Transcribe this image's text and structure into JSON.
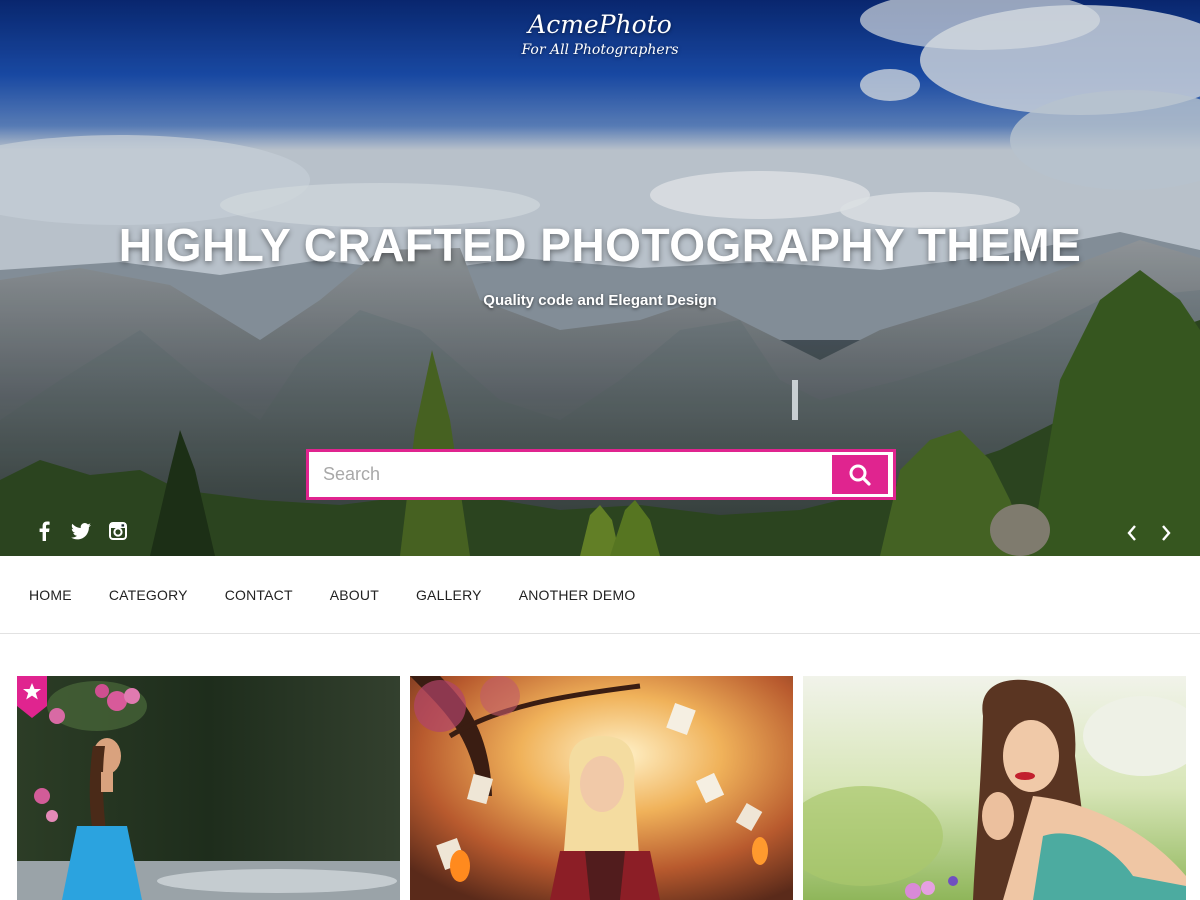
{
  "site": {
    "title": "AcmePhoto",
    "tagline": "For All Photographers"
  },
  "hero": {
    "heading": "HIGHLY CRAFTED PHOTOGRAPHY THEME",
    "subheading": "Quality code and Elegant Design"
  },
  "search": {
    "placeholder": "Search",
    "value": ""
  },
  "social": [
    "facebook-icon",
    "twitter-icon",
    "instagram-icon"
  ],
  "slider_controls": [
    "chevron-left-icon",
    "chevron-right-icon"
  ],
  "nav": {
    "items": [
      "HOME",
      "CATEGORY",
      "CONTACT",
      "ABOUT",
      "GALLERY",
      "ANOTHER DEMO"
    ]
  },
  "gallery": {
    "cards": [
      {
        "image": "woman in blue top by a river with pink flowers",
        "featured": true,
        "badge_icon": "star-icon"
      },
      {
        "image": "blonde woman in plaid shirt with flying pages in autumn forest",
        "featured": false
      },
      {
        "image": "woman with long hair lying in a flowery meadow",
        "featured": false
      }
    ]
  },
  "colors": {
    "accent": "#e0248f",
    "nav_text": "#222222",
    "hero_text": "#ffffff"
  }
}
